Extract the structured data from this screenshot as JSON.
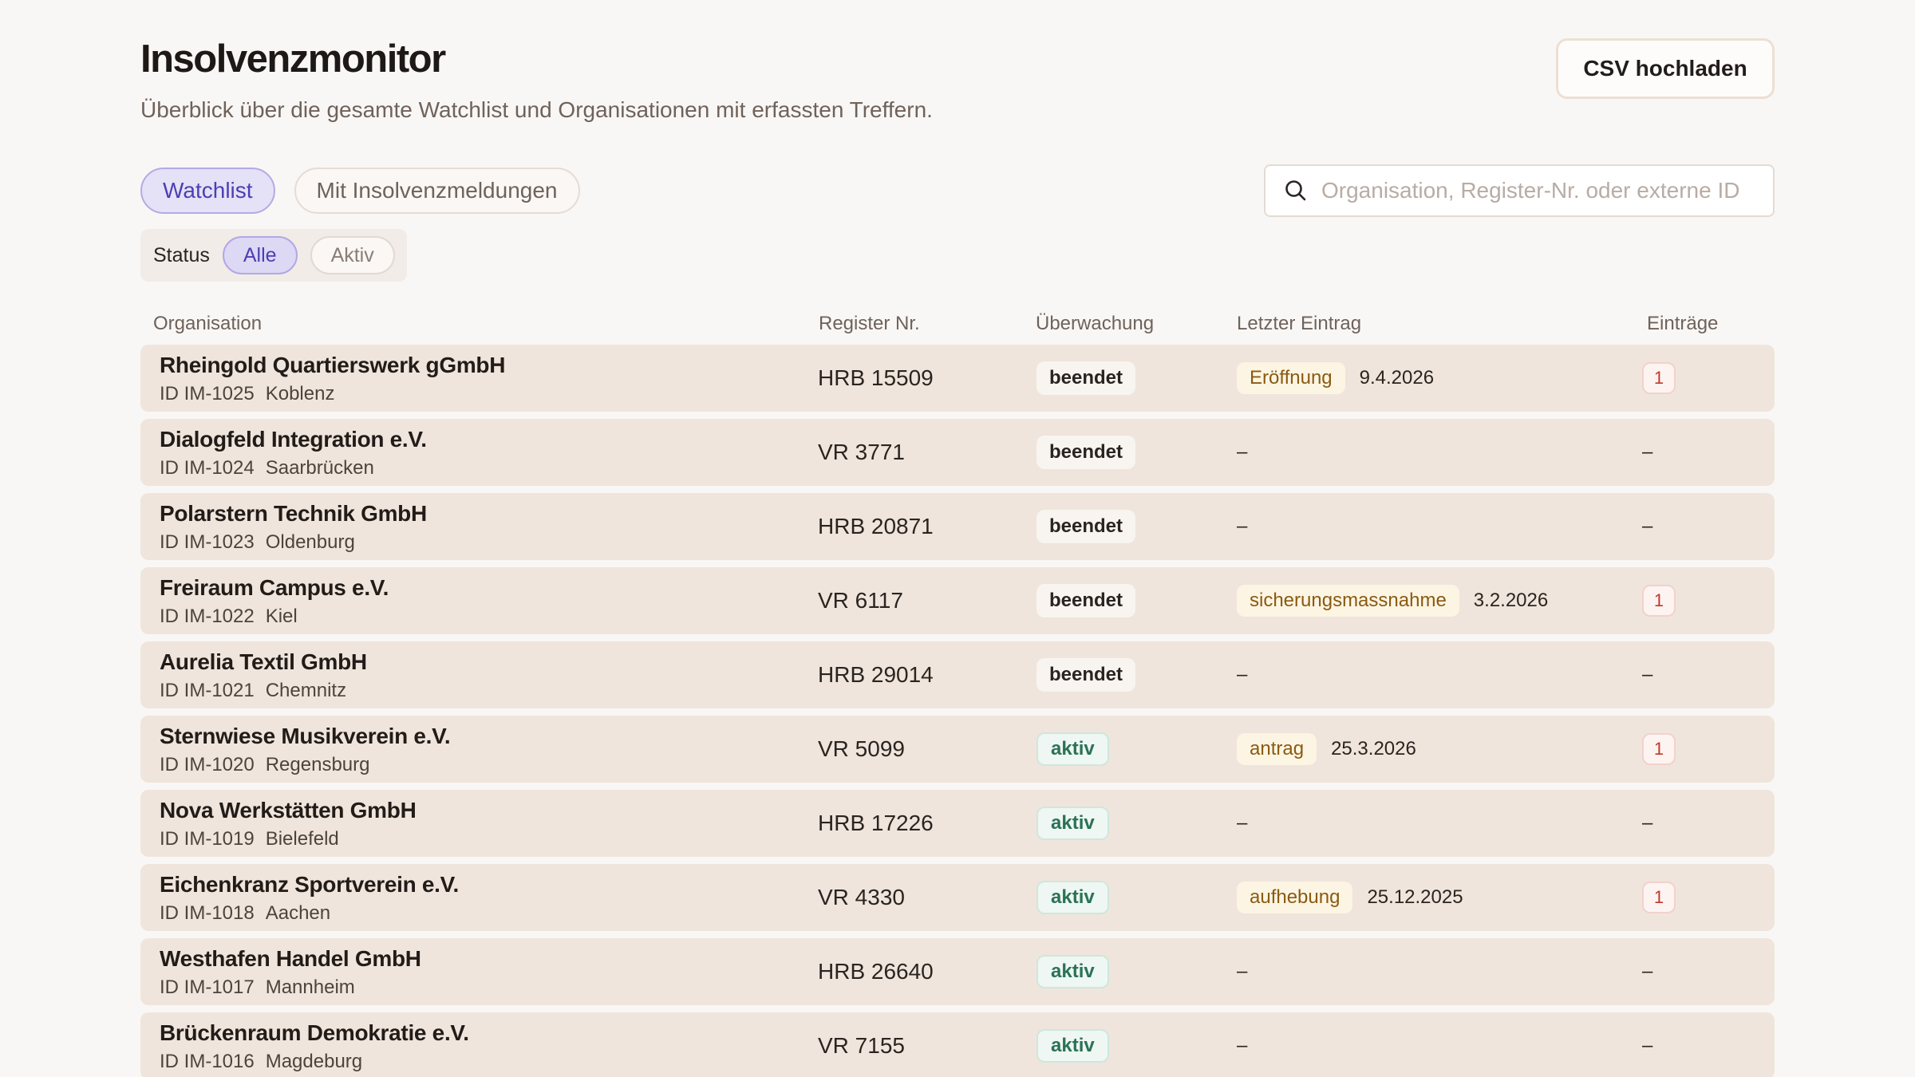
{
  "header": {
    "title": "Insolvenzmonitor",
    "subtitle": "Überblick über die gesamte Watchlist und Organisationen mit erfassten Treffern.",
    "upload_label": "CSV hochladen"
  },
  "tabs": [
    {
      "label": "Watchlist",
      "active": true
    },
    {
      "label": "Mit Insolvenzmeldungen",
      "active": false
    }
  ],
  "search": {
    "icon": "search-icon",
    "placeholder": "Organisation, Register-Nr. oder externe ID",
    "value": ""
  },
  "status_filter": {
    "label": "Status",
    "options": [
      {
        "label": "Alle",
        "active": true
      },
      {
        "label": "Aktiv",
        "active": false
      }
    ]
  },
  "table": {
    "columns": [
      "Organisation",
      "Register Nr.",
      "Überwachung",
      "Letzter Eintrag",
      "Einträge"
    ],
    "rows": [
      {
        "name": "Rheingold Quartierswerk gGmbH",
        "id": "ID IM-1025",
        "city": "Koblenz",
        "register": "HRB 15509",
        "monitoring": "beendet",
        "entry_type": "Eröffnung",
        "entry_date": "9.4.2026",
        "entries": "1"
      },
      {
        "name": "Dialogfeld Integration e.V.",
        "id": "ID IM-1024",
        "city": "Saarbrücken",
        "register": "VR 3771",
        "monitoring": "beendet",
        "entry_type": "",
        "entry_date": "–",
        "entries": "–"
      },
      {
        "name": "Polarstern Technik GmbH",
        "id": "ID IM-1023",
        "city": "Oldenburg",
        "register": "HRB 20871",
        "monitoring": "beendet",
        "entry_type": "",
        "entry_date": "–",
        "entries": "–"
      },
      {
        "name": "Freiraum Campus e.V.",
        "id": "ID IM-1022",
        "city": "Kiel",
        "register": "VR 6117",
        "monitoring": "beendet",
        "entry_type": "sicherungsmassnahme",
        "entry_date": "3.2.2026",
        "entries": "1"
      },
      {
        "name": "Aurelia Textil GmbH",
        "id": "ID IM-1021",
        "city": "Chemnitz",
        "register": "HRB 29014",
        "monitoring": "beendet",
        "entry_type": "",
        "entry_date": "–",
        "entries": "–"
      },
      {
        "name": "Sternwiese Musikverein e.V.",
        "id": "ID IM-1020",
        "city": "Regensburg",
        "register": "VR 5099",
        "monitoring": "aktiv",
        "entry_type": "antrag",
        "entry_date": "25.3.2026",
        "entries": "1"
      },
      {
        "name": "Nova Werkstätten GmbH",
        "id": "ID IM-1019",
        "city": "Bielefeld",
        "register": "HRB 17226",
        "monitoring": "aktiv",
        "entry_type": "",
        "entry_date": "–",
        "entries": "–"
      },
      {
        "name": "Eichenkranz Sportverein e.V.",
        "id": "ID IM-1018",
        "city": "Aachen",
        "register": "VR 4330",
        "monitoring": "aktiv",
        "entry_type": "aufhebung",
        "entry_date": "25.12.2025",
        "entries": "1"
      },
      {
        "name": "Westhafen Handel GmbH",
        "id": "ID IM-1017",
        "city": "Mannheim",
        "register": "HRB 26640",
        "monitoring": "aktiv",
        "entry_type": "",
        "entry_date": "–",
        "entries": "–"
      },
      {
        "name": "Brückenraum Demokratie e.V.",
        "id": "ID IM-1016",
        "city": "Magdeburg",
        "register": "VR 7155",
        "monitoring": "aktiv",
        "entry_type": "",
        "entry_date": "–",
        "entries": "–"
      }
    ]
  }
}
